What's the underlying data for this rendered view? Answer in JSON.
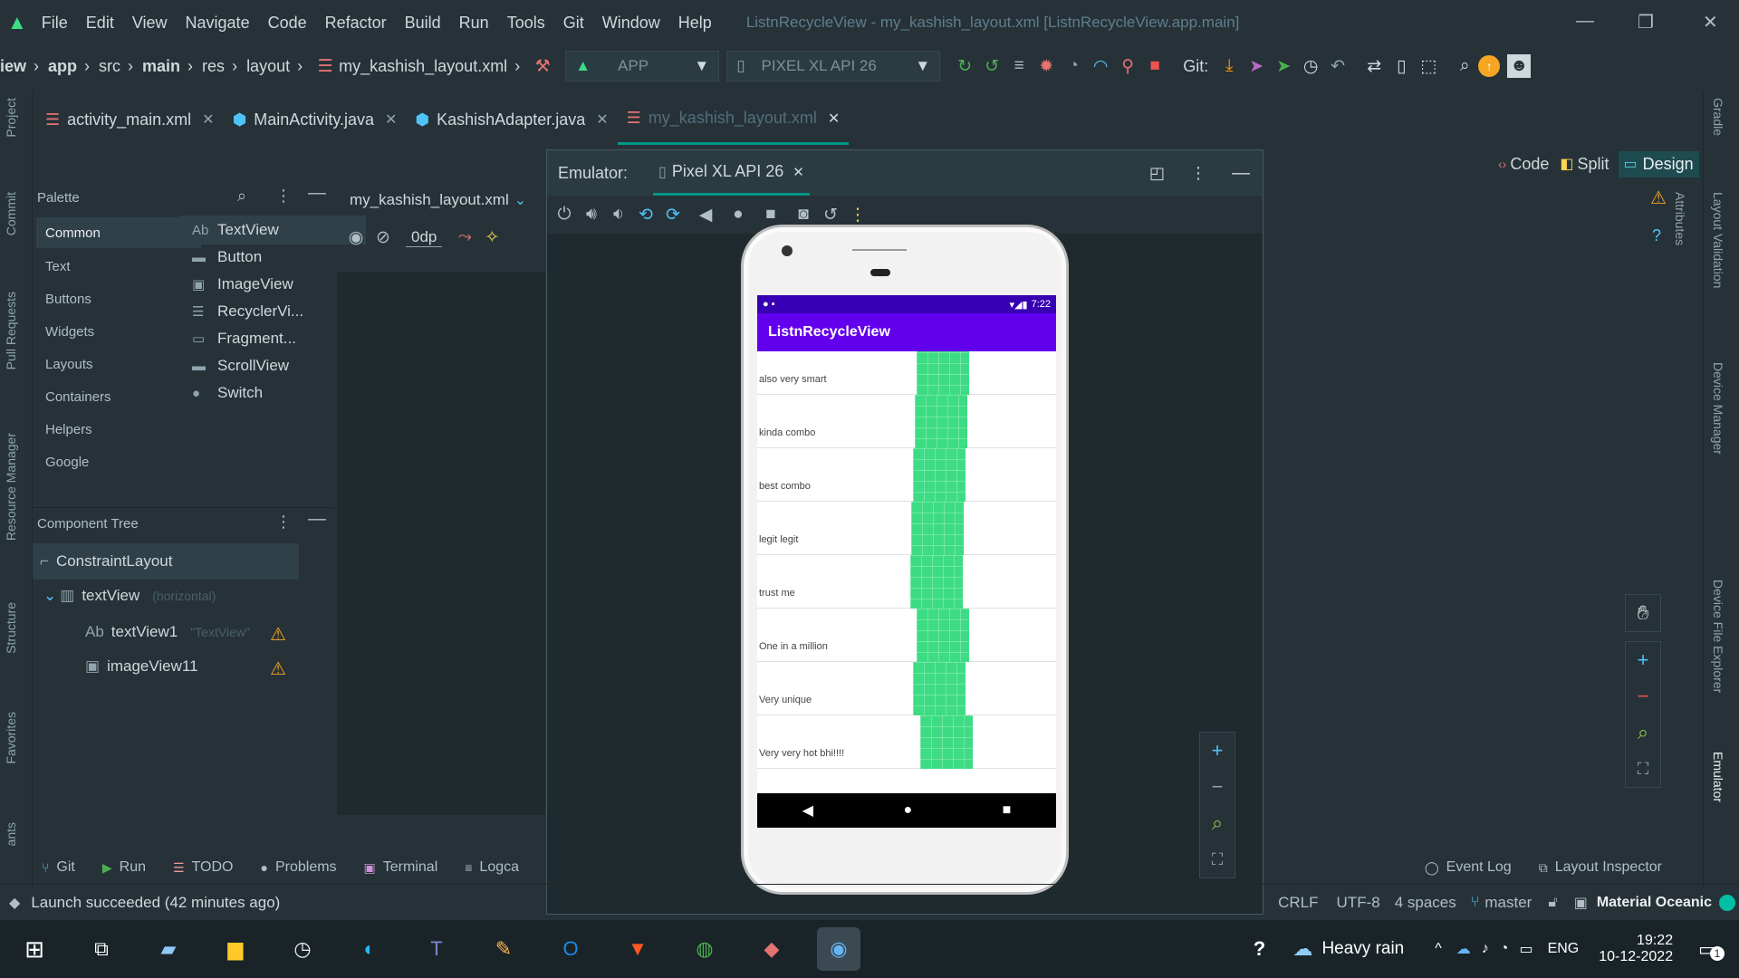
{
  "menubar": {
    "items": [
      "File",
      "Edit",
      "View",
      "Navigate",
      "Code",
      "Refactor",
      "Build",
      "Run",
      "Tools",
      "Git",
      "Window",
      "Help"
    ],
    "window_title": "ListnRecycleView - my_kashish_layout.xml [ListnRecycleView.app.main]"
  },
  "breadcrumb": {
    "items": [
      "iew",
      "app",
      "src",
      "main",
      "res",
      "layout",
      "my_kashish_layout.xml"
    ]
  },
  "run_config": {
    "label": "APP"
  },
  "device_selector": {
    "label": "PIXEL XL API 26"
  },
  "git_label": "Git:",
  "editor_tabs": [
    {
      "label": "activity_main.xml"
    },
    {
      "label": "MainActivity.java"
    },
    {
      "label": "KashishAdapter.java"
    },
    {
      "label": "my_kashish_layout.xml"
    }
  ],
  "left_strip": [
    "Project",
    "Commit",
    "Pull Requests",
    "Resource Manager",
    "Structure",
    "Favorites",
    "ants"
  ],
  "right_strip": [
    "Gradle",
    "Attributes",
    "Layout Validation",
    "Device Manager",
    "Device File Explorer",
    "Emulator"
  ],
  "palette": {
    "title": "Palette",
    "categories": [
      "Common",
      "Text",
      "Buttons",
      "Widgets",
      "Layouts",
      "Containers",
      "Helpers",
      "Google"
    ],
    "items": [
      {
        "icon": "Ab",
        "label": "TextView"
      },
      {
        "icon": "▬",
        "label": "Button"
      },
      {
        "icon": "▣",
        "label": "ImageView"
      },
      {
        "icon": "☰",
        "label": "RecyclerVi..."
      },
      {
        "icon": "▭",
        "label": "Fragment..."
      },
      {
        "icon": "▬",
        "label": "ScrollView"
      },
      {
        "icon": "●",
        "label": "Switch"
      }
    ]
  },
  "design_toolbar": {
    "file": "my_kashish_layout.xml",
    "margin": "0dp"
  },
  "component_tree": {
    "title": "Component Tree",
    "root": "ConstraintLayout",
    "child": {
      "label": "textView",
      "hint": "(horizontal)"
    },
    "leaf1": {
      "label": "textView1",
      "hint": "\"TextView\""
    },
    "leaf2": {
      "label": "imageView11"
    }
  },
  "view_modes": {
    "code": "Code",
    "split": "Split",
    "design": "Design"
  },
  "emulator": {
    "label": "Emulator:",
    "device_tab": "Pixel XL API 26",
    "status_time": "7:22",
    "app_title": "ListnRecycleView",
    "rows": [
      {
        "text": "also very smart"
      },
      {
        "text": "kinda combo"
      },
      {
        "text": "best combo"
      },
      {
        "text": "legit legit"
      },
      {
        "text": "trust me"
      },
      {
        "text": "One in a million"
      },
      {
        "text": "Very unique"
      },
      {
        "text": "Very very hot bhi!!!!"
      }
    ]
  },
  "bottom_tabs": [
    {
      "icon": "⑂",
      "label": "Git"
    },
    {
      "icon": "▶",
      "label": "Run"
    },
    {
      "icon": "☰",
      "label": "TODO"
    },
    {
      "icon": "●",
      "label": "Problems"
    },
    {
      "icon": "▣",
      "label": "Terminal"
    },
    {
      "icon": "≡",
      "label": "Logca"
    }
  ],
  "bottom_right_tabs": [
    {
      "label": "Event Log"
    },
    {
      "label": "Layout Inspector"
    }
  ],
  "status": {
    "message": "Launch succeeded (42 minutes ago)",
    "line_sep": "CRLF",
    "encoding": "UTF-8",
    "indent": "4 spaces",
    "branch": "master",
    "theme": "Material Oceanic"
  },
  "taskbar": {
    "weather": "Heavy rain",
    "lang": "ENG",
    "time": "19:22",
    "date": "10-12-2022",
    "notifications": "1"
  },
  "colors": {
    "accent": "#009688",
    "app_bar": "#6200ee",
    "status_bar": "#3700b3",
    "list_image": "#3ddc84",
    "warning": "#f5a623"
  }
}
